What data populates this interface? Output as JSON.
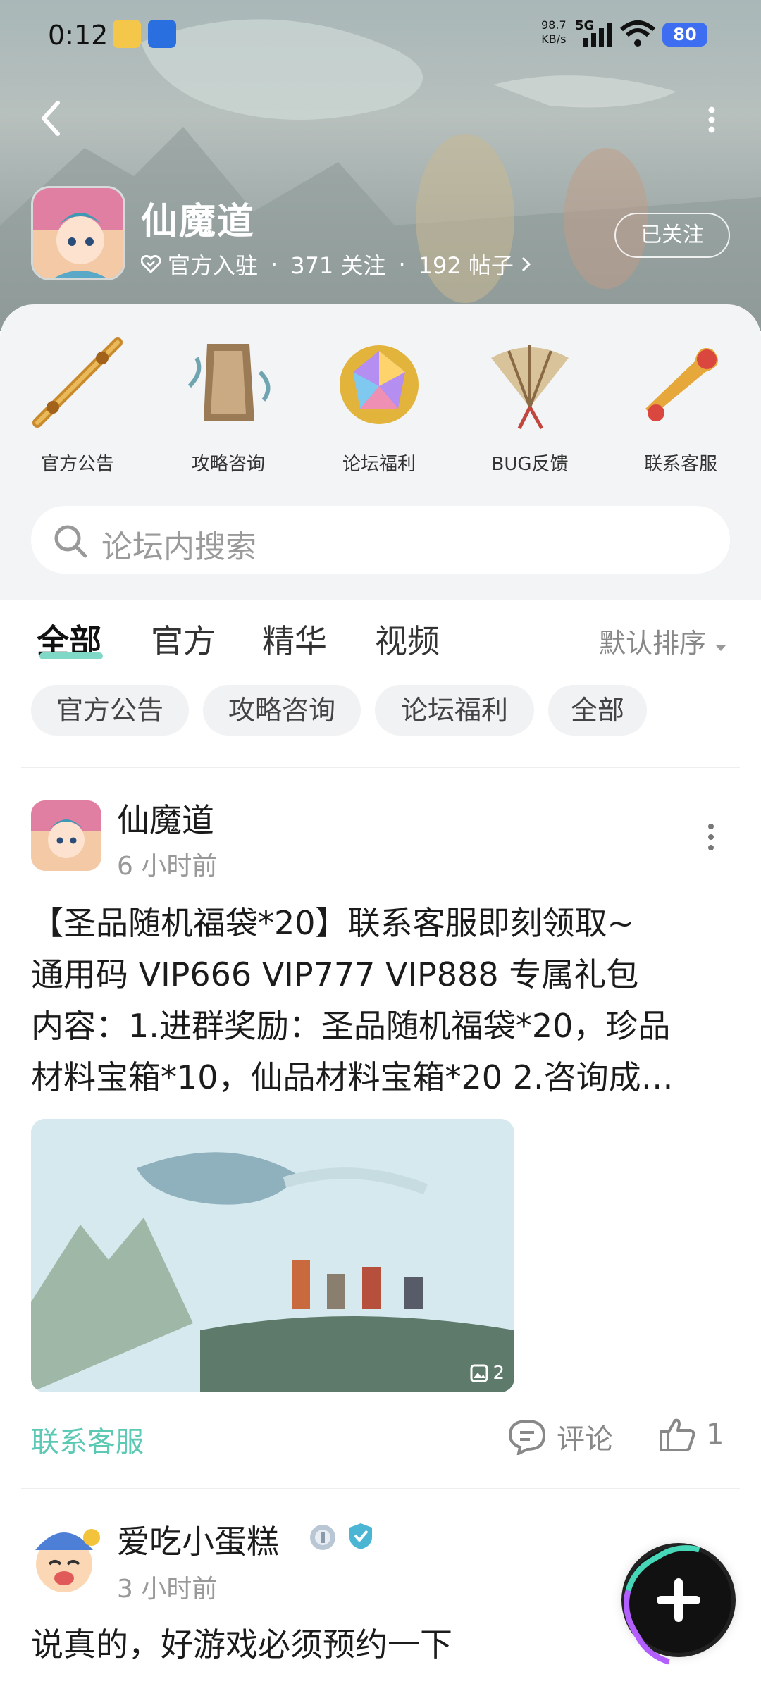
{
  "status_bar": {
    "time": "0:12",
    "net_speed_value": "98.7",
    "net_speed_unit": "KB/s",
    "network": "5G",
    "battery": "80"
  },
  "forum": {
    "name": "仙魔道",
    "badge": "官方入驻",
    "followers": "371 关注",
    "posts": "192 帖子",
    "follow_button": "已关注"
  },
  "shortcuts": [
    {
      "label": "官方公告",
      "icon": "flute-icon"
    },
    {
      "label": "攻略咨询",
      "icon": "tablet-icon"
    },
    {
      "label": "论坛福利",
      "icon": "gem-icon"
    },
    {
      "label": "BUG反馈",
      "icon": "fan-icon"
    },
    {
      "label": "联系客服",
      "icon": "ruyi-icon"
    }
  ],
  "search": {
    "placeholder": "论坛内搜索"
  },
  "tabs": [
    "全部",
    "官方",
    "精华",
    "视频"
  ],
  "active_tab": "全部",
  "sort": "默认排序",
  "chips": [
    "官方公告",
    "攻略咨询",
    "论坛福利",
    "全部"
  ],
  "posts": [
    {
      "author": "仙魔道",
      "time": "6 小时前",
      "lines": [
        "【圣品随机福袋*20】联系客服即刻领取~",
        "通用码 VIP666 VIP777 VIP888 专属礼包",
        "内容：1.进群奖励：圣品随机福袋*20，珍品",
        "材料宝箱*10，仙品材料宝箱*20 2.咨询成…"
      ],
      "image_count": "2",
      "tag": "联系客服",
      "comment_label": "评论",
      "likes": "1"
    },
    {
      "author": "爱吃小蛋糕",
      "time": "3 小时前",
      "lines": [
        "说真的，好游戏必须预约一下"
      ]
    }
  ],
  "colors": {
    "accent": "#5cc9b4",
    "tab_underline": "#7fd9c6",
    "battery": "#3d6df0"
  }
}
